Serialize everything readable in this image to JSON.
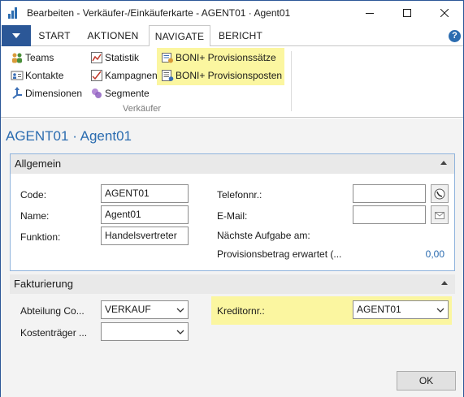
{
  "window": {
    "title": "Bearbeiten - Verkäufer-/Einkäuferkarte - AGENT01 · Agent01",
    "minimize_icon": "minimize-icon",
    "maximize_icon": "maximize-icon",
    "close_icon": "close-icon"
  },
  "ribbon": {
    "tabs": [
      "START",
      "AKTIONEN",
      "NAVIGATE",
      "BERICHT"
    ],
    "active_tab": "NAVIGATE",
    "group_label": "Verkäufer",
    "col1": [
      {
        "label": "Teams",
        "icon": "teams-icon"
      },
      {
        "label": "Kontakte",
        "icon": "contacts-icon"
      },
      {
        "label": "Dimensionen",
        "icon": "dimensions-icon"
      }
    ],
    "col2": [
      {
        "label": "Statistik",
        "icon": "statistics-icon"
      },
      {
        "label": "Kampagnen",
        "icon": "campaigns-icon"
      },
      {
        "label": "Segmente",
        "icon": "segments-icon"
      }
    ],
    "col3": [
      {
        "label": "BONI+ Provisionssätze",
        "icon": "commission-rates-icon"
      },
      {
        "label": "BONI+ Provisionsposten",
        "icon": "commission-entries-icon"
      }
    ],
    "highlight_color": "#fbf6a0"
  },
  "page": {
    "title": "AGENT01 · Agent01"
  },
  "general": {
    "title": "Allgemein",
    "code_label": "Code:",
    "code_value": "AGENT01",
    "name_label": "Name:",
    "name_value": "Agent01",
    "function_label": "Funktion:",
    "function_value": "Handelsvertreter",
    "phone_label": "Telefonnr.:",
    "phone_value": "",
    "email_label": "E-Mail:",
    "email_value": "",
    "next_task_label": "Nächste Aufgabe am:",
    "commission_label": "Provisionsbetrag erwartet (...",
    "commission_value": "0,00"
  },
  "billing": {
    "title": "Fakturierung",
    "department_label": "Abteilung Co...",
    "department_value": "VERKAUF",
    "costcarrier_label": "Kostenträger ...",
    "costcarrier_value": "",
    "creditor_label": "Kreditornr.:",
    "creditor_value": "AGENT01"
  },
  "buttons": {
    "ok": "OK"
  },
  "colors": {
    "accent": "#2b6cb0",
    "window_border": "#2b5797",
    "fasttab_border": "#8fb3dc"
  }
}
